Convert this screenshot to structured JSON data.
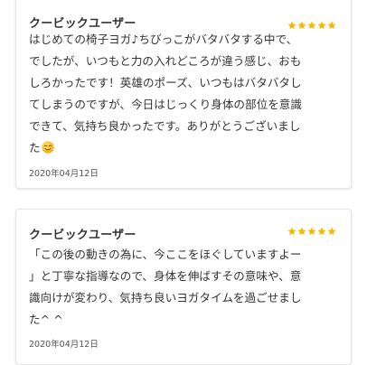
{
  "accent_color": "#f5b800",
  "reviews": [
    {
      "reviewer": "クービックユーザー",
      "rating": 5,
      "text_lines": [
        "はじめての椅子ヨガ♪ちびっこがバタバタする中で、",
        "でしたが、いつもと力の入れどころが違う感じ、おも",
        "しろかったです！英雄のポーズ、いつもはバタバタし",
        "てしまうのですが、今日はじっくり身体の部位を意識",
        "できて、気持ち良かったです。ありがとうございまし",
        "た"
      ],
      "emoji": "smiling-face-icon",
      "date": "2020年04月12日"
    },
    {
      "reviewer": "クービックユーザー",
      "rating": 5,
      "text_lines": [
        "「この後の動きの為に、今ここをほぐしていますよー",
        "」と丁寧な指導なので、身体を伸ばすその意味や、意",
        "識向けが変わり、気持ち良いヨガタイムを過ごせまし",
        "た^ ^"
      ],
      "date": "2020年04月12日"
    }
  ]
}
